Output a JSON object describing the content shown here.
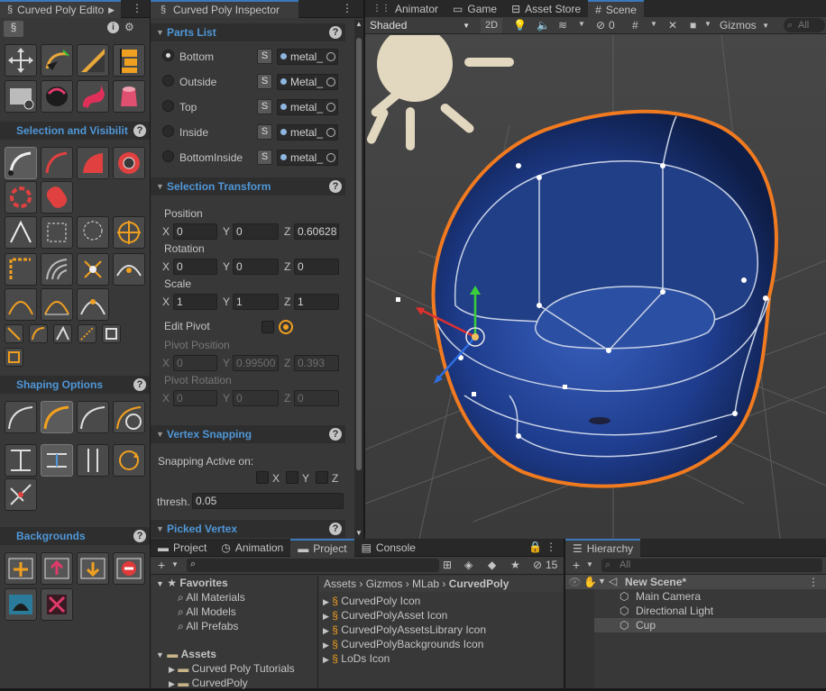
{
  "toolbox": {
    "title": "Curved Poly Edito",
    "sections": {
      "selection": "Selection and Visibilit",
      "shaping": "Shaping Options",
      "backgrounds": "Backgrounds"
    }
  },
  "inspector": {
    "tab": "Curved Poly Inspector",
    "parts_list": {
      "title": "Parts List",
      "parts": [
        {
          "name": "Bottom",
          "selected": true,
          "button": "S",
          "material": "metal_"
        },
        {
          "name": "Outside",
          "selected": false,
          "button": "S",
          "material": "Metal_"
        },
        {
          "name": "Top",
          "selected": false,
          "button": "S",
          "material": "metal_"
        },
        {
          "name": "Inside",
          "selected": false,
          "button": "S",
          "material": "metal_"
        },
        {
          "name": "BottomInside",
          "selected": false,
          "button": "S",
          "material": "metal_"
        }
      ]
    },
    "selection_transform": {
      "title": "Selection Transform",
      "position_label": "Position",
      "position": {
        "x": "0",
        "y": "0",
        "z": "0.60628"
      },
      "rotation_label": "Rotation",
      "rotation": {
        "x": "0",
        "y": "0",
        "z": "0"
      },
      "scale_label": "Scale",
      "scale": {
        "x": "1",
        "y": "1",
        "z": "1"
      },
      "edit_pivot_label": "Edit Pivot",
      "pivot_position_label": "Pivot Position",
      "pivot_position": {
        "x": "0",
        "y": "0.99500",
        "z": "0.393"
      },
      "pivot_rotation_label": "Pivot Rotation",
      "pivot_rotation": {
        "x": "0",
        "y": "0",
        "z": "0"
      },
      "axis_x": "X",
      "axis_y": "Y",
      "axis_z": "Z"
    },
    "vertex_snapping": {
      "title": "Vertex Snapping",
      "active_label": "Snapping Active on:",
      "x": "X",
      "y": "Y",
      "z": "Z",
      "thresh_label": "thresh.",
      "thresh_value": "0.05"
    },
    "picked_vertex": {
      "title": "Picked Vertex"
    }
  },
  "scene": {
    "tabs": [
      "Animator",
      "Game",
      "Asset Store",
      "Scene"
    ],
    "shading": "Shaded",
    "mode_2d": "2D",
    "hidden_count": "0",
    "gizmos": "Gizmos",
    "search_placeholder": "All"
  },
  "project": {
    "tabs": [
      "Project",
      "Animation",
      "Project",
      "Console"
    ],
    "hidden_count": "15",
    "favorites": {
      "label": "Favorites",
      "items": [
        "All Materials",
        "All Models",
        "All Prefabs"
      ]
    },
    "assets": {
      "label": "Assets",
      "items": [
        "Curved Poly Tutorials",
        "CurvedPoly"
      ]
    },
    "breadcrumb": [
      "Assets",
      "Gizmos",
      "MLab",
      "CurvedPoly"
    ],
    "files": [
      "CurvedPoly Icon",
      "CurvedPolyAsset Icon",
      "CurvedPolyAssetsLibrary Icon",
      "CurvedPolyBackgrounds Icon",
      "LoDs Icon"
    ]
  },
  "hierarchy": {
    "tab": "Hierarchy",
    "search_placeholder": "All",
    "scene_name": "New Scene*",
    "objects": [
      "Main Camera",
      "Directional Light",
      "Cup"
    ]
  },
  "colors": {
    "accent": "#4f97d8",
    "panel": "#383838",
    "selection_outline": "#f07a20",
    "cup": "#1d3f8c"
  }
}
